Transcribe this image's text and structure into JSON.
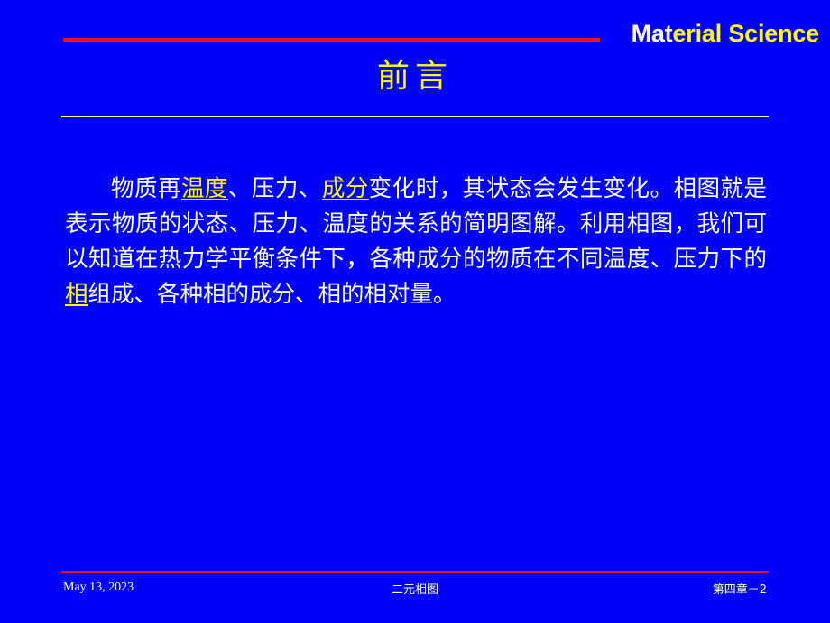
{
  "theme": {
    "background_color": "#0000FF",
    "accent_red": "#EE1111",
    "accent_yellow": "#FFFF00",
    "text_color": "#FFFFFF",
    "rule_yellow": "#FFFF66"
  },
  "header": {
    "brand_part_white": "Mat",
    "brand_part_yellow": "erial Science",
    "brand_full": "Material Science"
  },
  "title": {
    "text": "前言"
  },
  "body": {
    "paragraph_plain": "物质再温度、压力、成分变化时，其状态会发生变化。相图就是表示物质的状态、压力、温度的关系的简明图解。利用相图，我们可以知道在热力学平衡条件下，各种成分的物质在不同温度、压力下的相组成、各种相的成分、相的相对量。",
    "segments": [
      {
        "text": "物质再",
        "highlight": false
      },
      {
        "text": "温度",
        "highlight": true
      },
      {
        "text": "、压力、",
        "highlight": false
      },
      {
        "text": "成分",
        "highlight": true
      },
      {
        "text": "变化时，其状态会发生变化。相图就是表示物质的状态、压力、温度的关系的简明图解。利用相图，我们可以知道在热力学平衡条件下，各种成分的物质在不同温度、压力下的",
        "highlight": false
      },
      {
        "text": "相",
        "highlight": true
      },
      {
        "text": "组成、各种相的成分、相的相对量。",
        "highlight": false
      }
    ]
  },
  "footer": {
    "date": "May 13, 2023",
    "center": "二元相图",
    "page": "第四章－2"
  }
}
